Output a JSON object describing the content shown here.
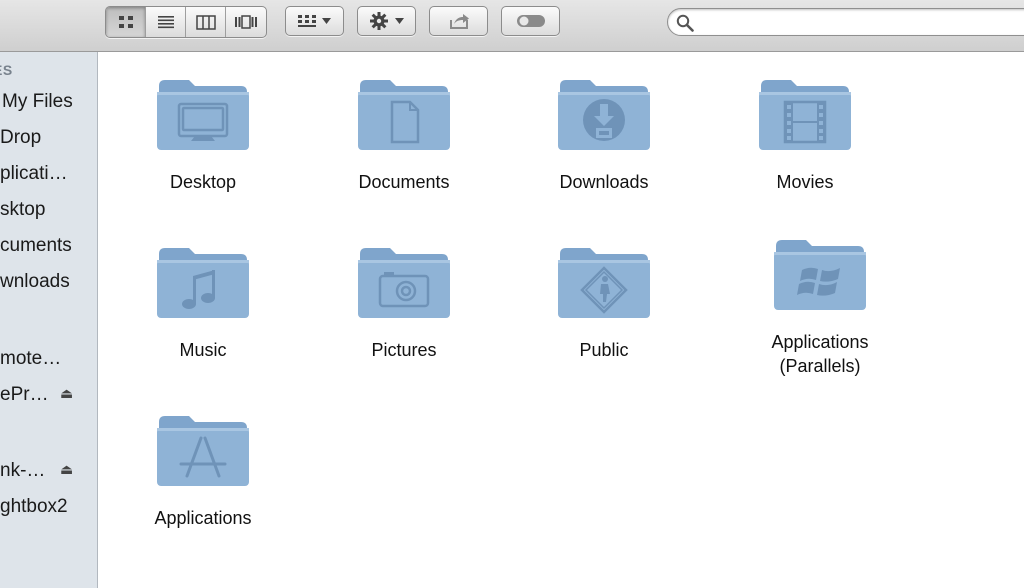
{
  "toolbar": {
    "view_buttons": [
      "icon-view",
      "list-view",
      "column-view",
      "coverflow-view"
    ],
    "active_view": "icon-view",
    "arrange_icon": "arrange-grid-icon",
    "action_icon": "gear-icon",
    "share_icon": "share-icon",
    "toggle_icon": "toggle-pill-icon",
    "search": {
      "value": "",
      "placeholder": ""
    }
  },
  "sidebar": {
    "section_header": "ES",
    "items": [
      {
        "label": "My Files",
        "icon": "all-my-files-icon"
      },
      {
        "label": "Drop",
        "icon": "airdrop-icon"
      },
      {
        "label": "plicati…",
        "icon": "applications-icon"
      },
      {
        "label": "sktop",
        "icon": "desktop-icon"
      },
      {
        "label": "cuments",
        "icon": "documents-icon"
      },
      {
        "label": "wnloads",
        "icon": "downloads-icon"
      },
      {
        "label": "mote…",
        "icon": "remote-disc-icon"
      },
      {
        "label": "ePr…",
        "icon": "drive-icon",
        "eject": true
      },
      {
        "label": "nk-…",
        "icon": "drive-icon",
        "eject": true
      },
      {
        "label": "ghtbox2",
        "icon": "drive-icon"
      }
    ],
    "eject_glyph": "⏏"
  },
  "folders": [
    {
      "name": "Desktop",
      "icon": "desktop-folder-icon"
    },
    {
      "name": "Documents",
      "icon": "documents-folder-icon"
    },
    {
      "name": "Downloads",
      "icon": "downloads-folder-icon"
    },
    {
      "name": "Movies",
      "icon": "movies-folder-icon"
    },
    {
      "name": "Music",
      "icon": "music-folder-icon"
    },
    {
      "name": "Pictures",
      "icon": "pictures-folder-icon"
    },
    {
      "name": "Public",
      "icon": "public-folder-icon"
    },
    {
      "name": "Applications",
      "name_line2": "(Parallels)",
      "icon": "windows-applications-folder-icon"
    },
    {
      "name": "Applications",
      "icon": "applications-folder-icon"
    }
  ],
  "colors": {
    "folder_body": "#8fb3d6",
    "folder_tab": "#7fa5cc",
    "folder_emboss": "#6f93b8",
    "sidebar_bg": "#dee4ea"
  }
}
